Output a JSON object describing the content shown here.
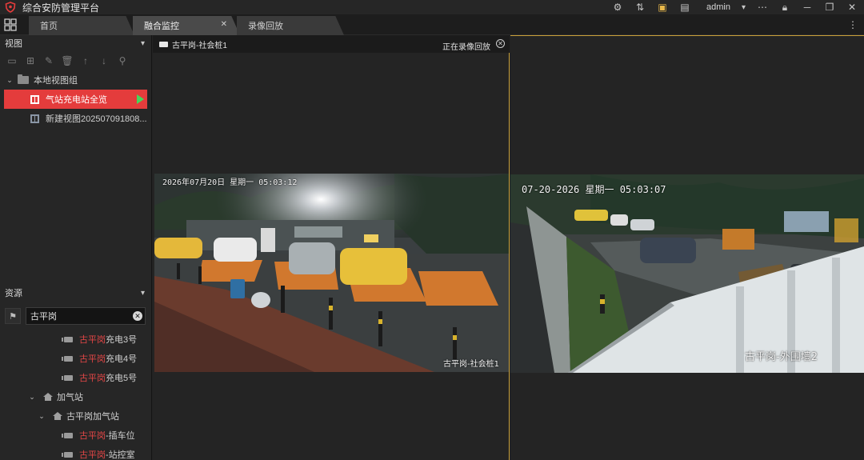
{
  "app": {
    "title": "综合安防管理平台",
    "user": "admin"
  },
  "colors": {
    "accent_red": "#e43c3c",
    "play_green": "#46d65a",
    "selected_border": "#c9a03a",
    "highlight_text": "#e04545"
  },
  "tabs": [
    {
      "label": "首页",
      "active": false
    },
    {
      "label": "融合监控",
      "active": true
    },
    {
      "label": "录像回放",
      "active": false
    }
  ],
  "views_panel": {
    "title": "视图",
    "group": "本地视图组",
    "items": [
      {
        "label": "气站充电站全览",
        "selected": true
      },
      {
        "label": "新建视图202507091808...",
        "selected": false
      }
    ]
  },
  "resources_panel": {
    "title": "资源",
    "search_value": "古平岗",
    "tree": [
      {
        "prefix": "古平岗",
        "suffix": "充电3号",
        "type": "camera"
      },
      {
        "prefix": "古平岗",
        "suffix": "充电4号",
        "type": "camera"
      },
      {
        "prefix": "古平岗",
        "suffix": "充电5号",
        "type": "camera"
      },
      {
        "label": "加气站",
        "type": "group"
      },
      {
        "label": "古平岗加气站",
        "type": "site"
      },
      {
        "prefix": "古平岗",
        "suffix": "-插车位",
        "type": "camera"
      },
      {
        "prefix": "古平岗",
        "suffix": "-站控室",
        "type": "camera"
      }
    ]
  },
  "panes": [
    {
      "header_title": "古平岗-社会桩1",
      "header_status": "正在录像回放",
      "osd_time": "2026年07月20日 星期一 05:03:12",
      "osd_name": "古平岗-社会桩1"
    },
    {
      "osd_time": "07-20-2026 星期一 05:03:07",
      "osd_name": "古平岗-外围墙2"
    }
  ]
}
